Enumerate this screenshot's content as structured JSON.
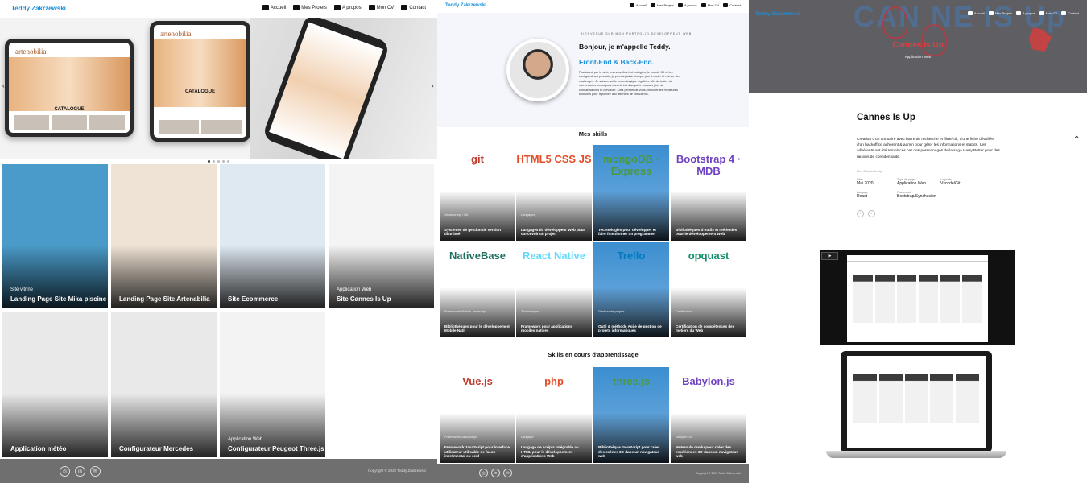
{
  "panel1": {
    "brand": "Teddy Zakrzewski",
    "nav": [
      {
        "label": "Accueil",
        "icon": "home-icon"
      },
      {
        "label": "Mes Projets",
        "icon": "sitemap-icon"
      },
      {
        "label": "A propos",
        "icon": "user-icon"
      },
      {
        "label": "Mon CV",
        "icon": "id-card-icon"
      },
      {
        "label": "Contact",
        "icon": "envelope-icon"
      }
    ],
    "carousel": {
      "tablet_a_logo": "artenobilia",
      "tablet_a_caption": "CATALOGUE",
      "tablet_b_logo": "artenobilia",
      "tablet_b_caption": "CATALOGUE",
      "prev": "‹",
      "next": "›",
      "slide_count": 5,
      "active_slide": 1
    },
    "projects": [
      {
        "category": "Site vitrine",
        "title": "Landing Page Site Mika piscine",
        "bg": "#4a9bc9"
      },
      {
        "category": "",
        "title": "Landing Page Site Artenabilia",
        "bg": "#efe3d5"
      },
      {
        "category": "",
        "title": "Site Ecommerce",
        "bg": "#dfe9f1"
      },
      {
        "category": "Application Web",
        "title": "Site Cannes Is Up",
        "bg": "#f4f4f4"
      },
      {
        "category": "",
        "title": "Application météo",
        "bg": "#e9e9e9"
      },
      {
        "category": "",
        "title": "Configurateur Mercedes",
        "bg": "#e9e9e9"
      },
      {
        "category": "Application Web",
        "title": "Configurateur Peugeot Three.js",
        "bg": "#f3f3f3"
      }
    ],
    "footer": {
      "copyright": "Copyright © 2020 Teddy Zakrzewski",
      "socials": [
        {
          "name": "github-icon",
          "glyph": "◎"
        },
        {
          "name": "linkedin-icon",
          "glyph": "in"
        },
        {
          "name": "mail-icon",
          "glyph": "✉"
        }
      ]
    }
  },
  "panel2": {
    "brand": "Teddy Zakrzewski",
    "nav": [
      "Accueil",
      "Mes Projets",
      "A propos",
      "Mon CV",
      "Contact"
    ],
    "hero": {
      "welcome": "BIENVENUE SUR MON PORTFOLIO DÉVELOPPEUR WEB",
      "hello": "Bonjour, je m'appelle Teddy.",
      "role": "Front-End & Back-End.",
      "bio": "Passionné par le web, les nouvelles technologies, le monde 3D et les configurateurs produits, je prends plaisir chaque jour à coder et relever des challenges. Je suis en veille technologique régulière afin de tester de nombreuses techniques dans le but d'acquérir toujours plus de connaissances et d'évoluer. Cela permet de vous proposer les meilleures solutions pour répondre aux attentes de vos clients."
    },
    "skills_title": "Mes skills",
    "skills": [
      {
        "logo": "git",
        "kind": "Versionning / Git",
        "desc": "Systèmes de gestion de version distribué"
      },
      {
        "logo": "HTML5 CSS JS",
        "kind": "Langages",
        "desc": "Langages du développeur Web pour concevoir un projet"
      },
      {
        "logo": "mongoDB · Express",
        "kind": "",
        "desc": "Technologies pour développer et faire fonctionner un programme"
      },
      {
        "logo": "Bootstrap 4 · MDB",
        "kind": "",
        "desc": "Bibliothèques d'outils et méthodes pour le développement Web"
      },
      {
        "logo": "NativeBase",
        "kind": "Framework Mobile Javascript",
        "desc": "Bibliothèques pour le développement Mobile Natif"
      },
      {
        "logo": "React Native",
        "kind": "Technologies",
        "desc": "Framework pour applications mobiles natives"
      },
      {
        "logo": "Trello",
        "kind": "Gestion de projets",
        "desc": "Outil & méthode Agile de gestion de projets informatiques"
      },
      {
        "logo": "opquast",
        "kind": "Certification",
        "desc": "Certification de compétences des métiers du Web"
      }
    ],
    "learning_title": "Skills en cours d'apprentissage",
    "learning": [
      {
        "logo": "Vue.js",
        "kind": "Framework JavaScript",
        "desc": "Framework JavaScript pour interface utilisateur utilisable de façon incrémental ou seul"
      },
      {
        "logo": "php",
        "kind": "Langage",
        "desc": "Langage de scripts intégrable au HTML pour le développement d'applications Web"
      },
      {
        "logo": "three.js",
        "kind": "",
        "desc": "Bibliothèque JavaScript pour créer des scènes 3D dans un navigateur web"
      },
      {
        "logo": "Babylon.js",
        "kind": "Babylon JS",
        "desc": "Moteur de rendu pour créer des expériences 3D dans un navigateur web"
      }
    ],
    "footer": {
      "copyright": "Copyright © 2020 Teddy Zakrzewski",
      "socials": [
        "◎",
        "in",
        "✉"
      ]
    }
  },
  "panel3": {
    "brand": "Teddy Zakrzewski",
    "nav": [
      "Accueil",
      "Mes Projets",
      "A propos",
      "Mon CV",
      "Contact"
    ],
    "hero": {
      "title": "Cannes Is Up",
      "subtitle": "Application Web",
      "bg_letters": "CAN NE IS Up"
    },
    "detail": {
      "title": "Cannes Is Up",
      "description": "Création d'un annuaire avec barre de recherche et filtre/roll, d'une fiche détaillée, d'un backoffice adhérent & admin pour gérer les informations et statuts. Les adhérents ont été remplacés par des personnages de la saga Harry Potter pour des raisons de confidentialité.",
      "more": "Mes Cannes Is Up",
      "meta": [
        {
          "k": "Date",
          "v": "Mai 2020"
        },
        {
          "k": "Type de projet",
          "v": "Application Web"
        },
        {
          "k": "Logiciels",
          "v": "Vscode/Git"
        },
        {
          "k": "Langage",
          "v": "React"
        },
        {
          "k": "Framework",
          "v": "Bootstrap/Synchusion"
        }
      ],
      "prev": "‹",
      "next": "›"
    },
    "video": {
      "play": "▶"
    },
    "scroll_up": "⌃"
  }
}
